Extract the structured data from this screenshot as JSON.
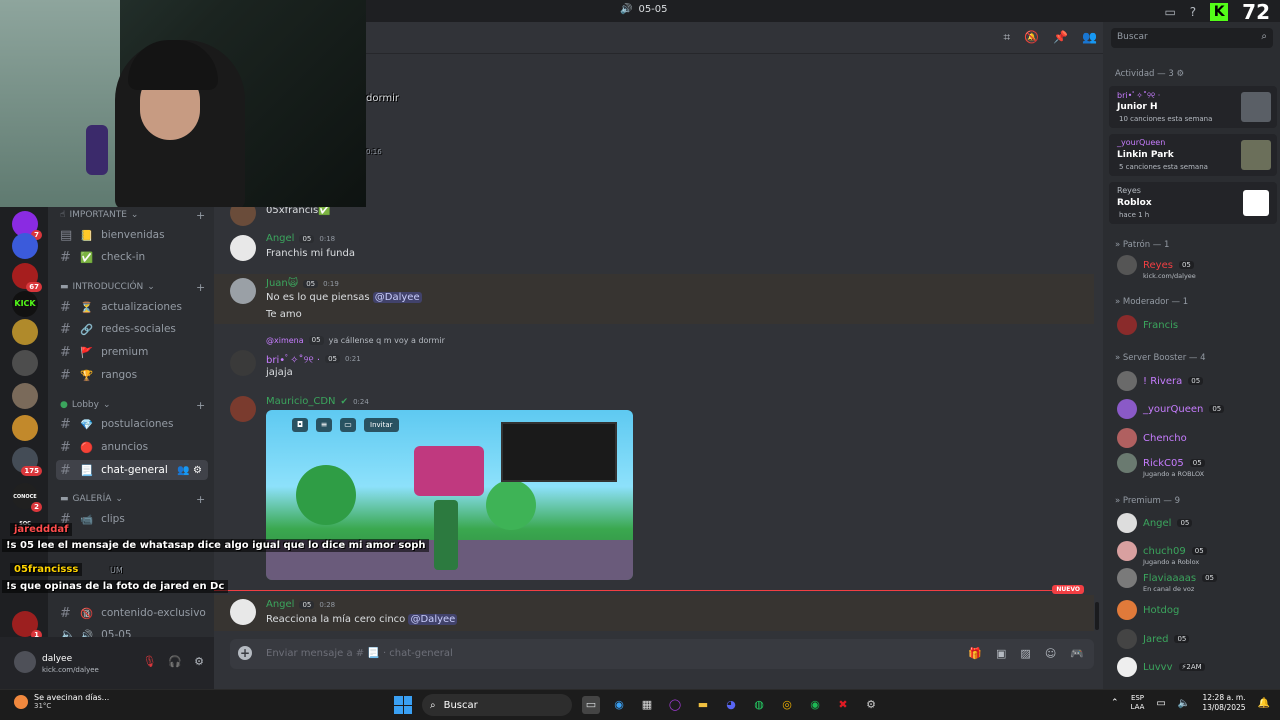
{
  "topbar": {
    "title": "05-05",
    "viewers": "72",
    "kick_letter": "K"
  },
  "servers": [
    {
      "label": "",
      "badge": "7",
      "color": "#8a2be2"
    },
    {
      "label": "",
      "badge": "",
      "color": "#3b5bdb"
    },
    {
      "label": "",
      "badge": "67",
      "color": "#a61e1e"
    },
    {
      "label": "KICK",
      "badge": "",
      "color": "#111111"
    },
    {
      "label": "",
      "badge": "",
      "color": "#b08a2b"
    },
    {
      "label": "",
      "badge": "",
      "color": "#4d4d4d"
    },
    {
      "label": "",
      "badge": "",
      "color": "#7a6a5a"
    },
    {
      "label": "",
      "badge": "",
      "color": "#c2892b"
    },
    {
      "label": "",
      "badge": "175",
      "color": "#444c56"
    },
    {
      "label": "CONOCE SOC",
      "badge": "2",
      "color": "#202020"
    },
    {
      "label": "",
      "badge": "1",
      "color": "#9c1f1f"
    }
  ],
  "channels": {
    "categories": [
      {
        "label": "IMPORTANTE",
        "prefix": "☝"
      },
      {
        "label": "INTRODUCCIÓN",
        "prefix": "▬"
      },
      {
        "label": "Lobby",
        "prefix": "●"
      },
      {
        "label": "GALERÍA",
        "prefix": "▬"
      }
    ],
    "items": [
      {
        "name": "bienvenidas",
        "emoji": "📒"
      },
      {
        "name": "check-in",
        "emoji": "✅"
      },
      {
        "name": "actualizaciones",
        "emoji": "⏳"
      },
      {
        "name": "redes-sociales",
        "emoji": "🔗"
      },
      {
        "name": "premium",
        "emoji": "🚩"
      },
      {
        "name": "rangos",
        "emoji": "🏆"
      },
      {
        "name": "postulaciones",
        "emoji": "💎"
      },
      {
        "name": "anuncios",
        "emoji": "🔴"
      },
      {
        "name": "chat-general",
        "emoji": "📃"
      },
      {
        "name": "clips",
        "emoji": "📹"
      },
      {
        "name": "contenido-exclusivo",
        "emoji": "🔞"
      },
      {
        "name": "05-05",
        "emoji": "🔊"
      }
    ]
  },
  "userpanel": {
    "name": "dalyee",
    "sub": "kick.com/dalyee"
  },
  "overlay": {
    "partial_dormir": "dormir",
    "partial_time": "0:16",
    "jared_name": "jaredddaf",
    "jared_msg": "!s 05 lee el mensaje de whatasap dice algo igual que lo dice mi amor soph",
    "francis_name": "05francisss",
    "francis_msg": "!s que opinas de la foto de jared en Dc",
    "partial_um": "UM"
  },
  "messages": [
    {
      "author": "",
      "text": "05xfrancis✅",
      "color": "#dbdee1",
      "time": ""
    },
    {
      "author": "Angel",
      "tag": "05",
      "time": "0:18",
      "text": "Franchis mi funda",
      "color": "#3ba55d"
    },
    {
      "author": "Juan🙀",
      "tag": "05",
      "time": "0:19",
      "text_pre": "No es lo que piensas ",
      "mention": "@Dalyee",
      "text2": "Te amo",
      "color": "#3ba55d"
    },
    {
      "reply_user": "@ximena",
      "reply_tag": "05",
      "reply_text": "ya cállense q m voy a dormir",
      "author": "bri•ﾟ✧˚୨୧ ·",
      "tag": "05",
      "time": "0:21",
      "text": "jajaja",
      "color": "#c77dff"
    },
    {
      "author": "Mauricio_CDN",
      "time": "0:24",
      "color": "#3ba55d",
      "invite": "Invitar"
    },
    {
      "author": "Angel",
      "tag": "05",
      "time": "0:28",
      "text_pre": "Reacciona la mía cero cinco ",
      "mention": "@Dalyee",
      "color": "#3ba55d"
    }
  ],
  "new_label": "NUEVO",
  "composer": {
    "placeholder": "Enviar mensaje a # 📃 · chat-general"
  },
  "members": {
    "search_placeholder": "Buscar",
    "activity_header": "Actividad — 3",
    "activities": [
      {
        "who": "bri•ﾟ✧˚୨୧ ·",
        "game": "Junior H",
        "sub": "10 canciones esta semana"
      },
      {
        "who": "_yourQueen",
        "game": "Linkin Park",
        "sub": "5 canciones esta semana"
      },
      {
        "who": "Reyes",
        "game": "Roblox",
        "sub": "hace 1 h"
      }
    ],
    "sections": [
      {
        "label": "» Patrón — 1"
      },
      {
        "label": "» Moderador — 1"
      },
      {
        "label": "» Server Booster — 4"
      },
      {
        "label": "» Premium — 9"
      }
    ],
    "list": [
      {
        "name": "Reyes",
        "tag": "05",
        "sub": "kick.com/dalyee",
        "color": "#f23f43"
      },
      {
        "name": "Francis",
        "tag": "",
        "sub": "",
        "color": "#3ba55d"
      },
      {
        "name": "! Rivera",
        "tag": "05",
        "sub": "",
        "color": "#c77dff"
      },
      {
        "name": "_yourQueen",
        "tag": "05",
        "sub": "",
        "color": "#c77dff"
      },
      {
        "name": "Chencho",
        "tag": "",
        "sub": "",
        "color": "#c77dff"
      },
      {
        "name": "RickC05",
        "tag": "05",
        "sub": "Jugando a ROBLOX",
        "color": "#c77dff"
      },
      {
        "name": "Angel",
        "tag": "05",
        "sub": "",
        "color": "#3ba55d"
      },
      {
        "name": "chuch09",
        "tag": "05",
        "sub": "Jugando a Roblox",
        "color": "#3ba55d"
      },
      {
        "name": "Flaviaaaas",
        "tag": "05",
        "sub": "En canal de voz",
        "color": "#3ba55d"
      },
      {
        "name": "Hotdog",
        "tag": "",
        "sub": "",
        "color": "#3ba55d"
      },
      {
        "name": "Jared",
        "tag": "05",
        "sub": "",
        "color": "#3ba55d"
      },
      {
        "name": "Luvvv",
        "tag": "⚡2AM",
        "sub": "",
        "color": "#3ba55d"
      }
    ]
  },
  "taskbar": {
    "weather_title": "Se avecinan días...",
    "weather_temp": "31°C",
    "search_label": "Buscar",
    "lang1": "ESP",
    "lang2": "LAA",
    "time": "12:28 a. m.",
    "date": "13/08/2025"
  }
}
